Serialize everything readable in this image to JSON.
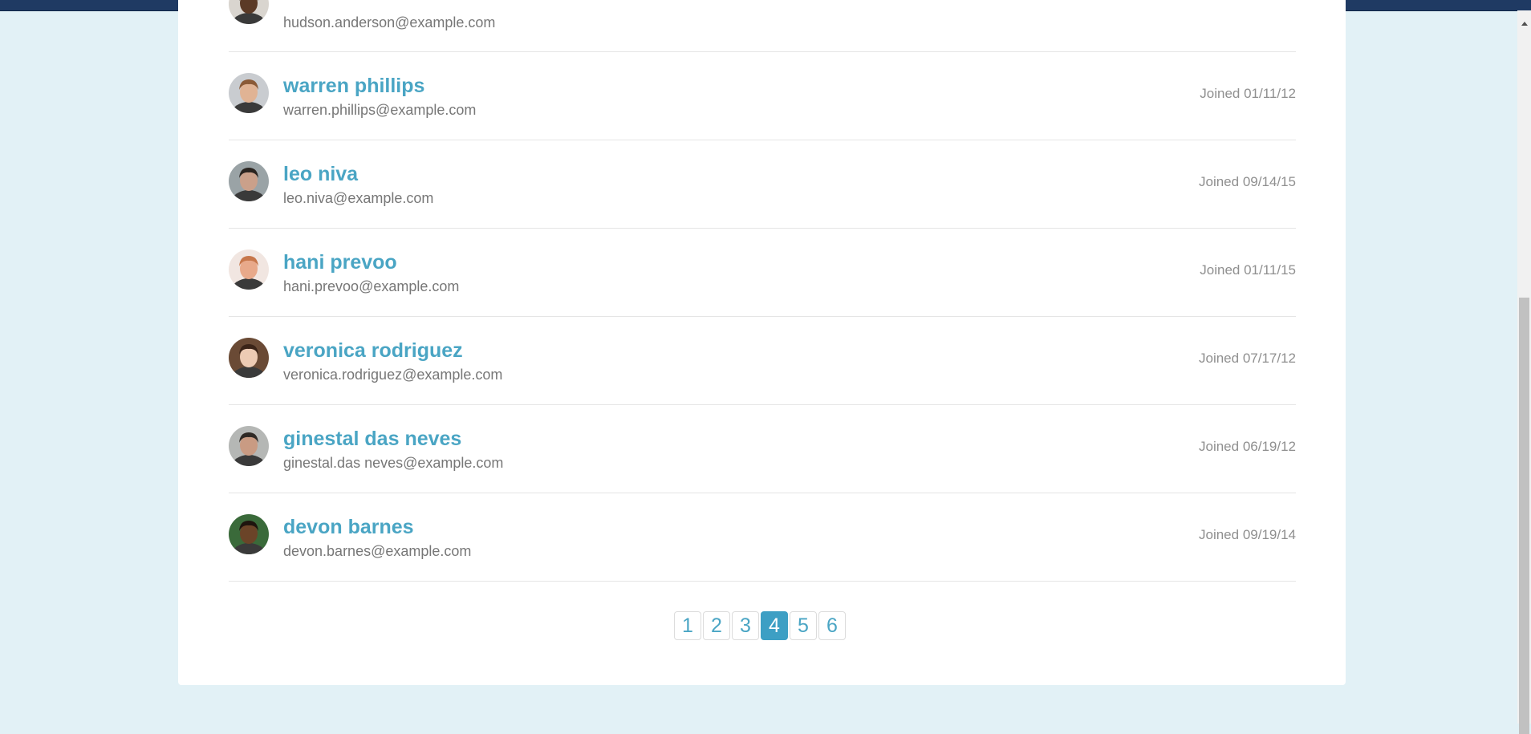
{
  "users": [
    {
      "name": "",
      "email": "hudson.anderson@example.com",
      "joined": "",
      "avatar_skin": "#5b3a26",
      "avatar_bg": "#d9d5cf",
      "avatar_hair": "#1b1410"
    },
    {
      "name": "warren phillips",
      "email": "warren.phillips@example.com",
      "joined": "Joined 01/11/12",
      "avatar_skin": "#e0b394",
      "avatar_bg": "#c9ccd0",
      "avatar_hair": "#8a5a37"
    },
    {
      "name": "leo niva",
      "email": "leo.niva@example.com",
      "joined": "Joined 09/14/15",
      "avatar_skin": "#caa08a",
      "avatar_bg": "#9aa3a6",
      "avatar_hair": "#2a2420"
    },
    {
      "name": "hani prevoo",
      "email": "hani.prevoo@example.com",
      "joined": "Joined 01/11/15",
      "avatar_skin": "#e8a98a",
      "avatar_bg": "#f1e6e1",
      "avatar_hair": "#c7774b"
    },
    {
      "name": "veronica rodriguez",
      "email": "veronica.rodriguez@example.com",
      "joined": "Joined 07/17/12",
      "avatar_skin": "#edcbb4",
      "avatar_bg": "#6a4a35",
      "avatar_hair": "#3b2418"
    },
    {
      "name": "ginestal das neves",
      "email": "ginestal.das neves@example.com",
      "joined": "Joined 06/19/12",
      "avatar_skin": "#c99b83",
      "avatar_bg": "#b5b7b5",
      "avatar_hair": "#2f2925"
    },
    {
      "name": "devon barnes",
      "email": "devon.barnes@example.com",
      "joined": "Joined 09/19/14",
      "avatar_skin": "#6b4428",
      "avatar_bg": "#3a6a3a",
      "avatar_hair": "#1e140e"
    }
  ],
  "pagination": {
    "pages": [
      "1",
      "2",
      "3",
      "4",
      "5",
      "6"
    ],
    "current": "4"
  },
  "colors": {
    "background": "#e2f1f6",
    "accent": "#4aa5c4",
    "active_page": "#3d9fc4",
    "topbar": "#1f3a63"
  }
}
